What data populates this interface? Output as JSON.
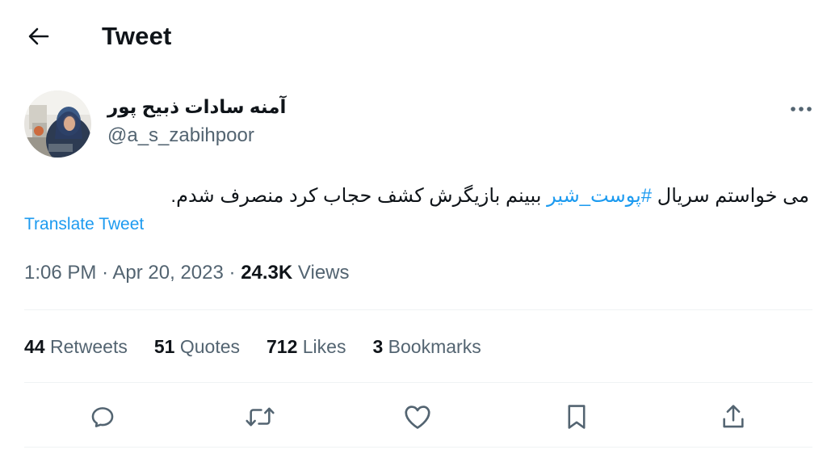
{
  "header": {
    "title": "Tweet",
    "back_icon": "arrow-left-icon"
  },
  "author": {
    "display_name": "آمنه سادات ذبیح پور",
    "handle": "@a_s_zabihpoor"
  },
  "tweet": {
    "text_before": "می خواستم سریال ",
    "hashtag": "#پوست_شیر",
    "text_after": " ببینم بازیگرش کشف حجاب کرد منصرف شدم.",
    "translate_label": "Translate Tweet"
  },
  "meta": {
    "time": "1:06 PM",
    "separator": "·",
    "date": "Apr 20, 2023",
    "views_count": "24.3K",
    "views_label": "Views"
  },
  "stats": {
    "retweets_count": "44",
    "retweets_label": "Retweets",
    "quotes_count": "51",
    "quotes_label": "Quotes",
    "likes_count": "712",
    "likes_label": "Likes",
    "bookmarks_count": "3",
    "bookmarks_label": "Bookmarks"
  },
  "actions": [
    "reply-icon",
    "retweet-icon",
    "like-icon",
    "bookmark-icon",
    "share-icon"
  ],
  "colors": {
    "accent": "#1d9bf0",
    "text": "#0f1419",
    "secondary": "#536471",
    "divider": "#eff3f4"
  }
}
